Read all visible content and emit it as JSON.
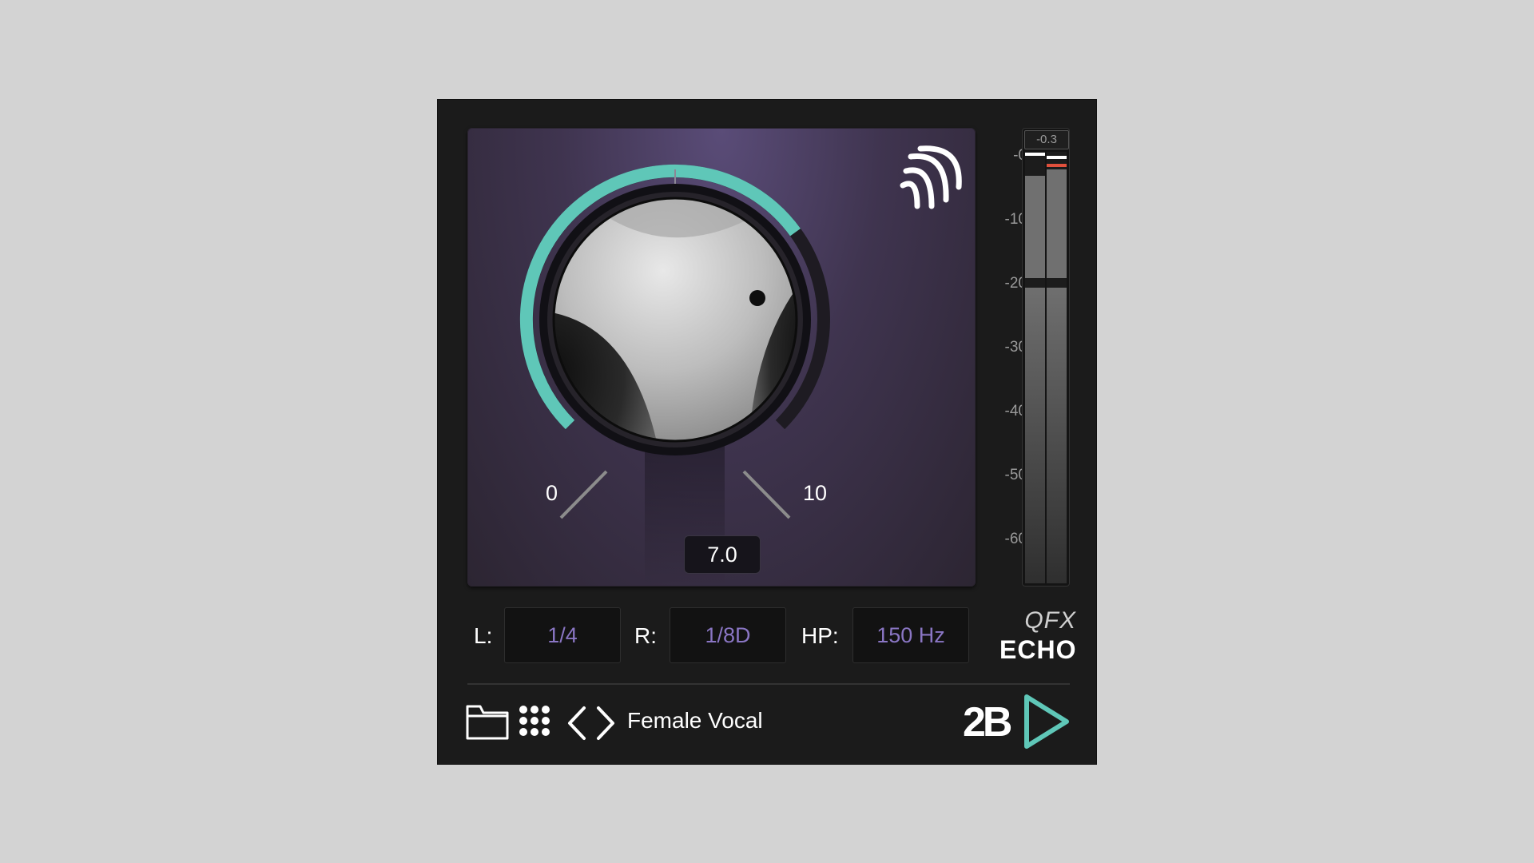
{
  "knob": {
    "min_label": "0",
    "max_label": "10",
    "value_text": "7.0",
    "value": 7.0,
    "min": 0,
    "max": 10
  },
  "meter": {
    "peak_readout": "-0.3",
    "scale_ticks": [
      "-0",
      "-10",
      "-20",
      "-30",
      "-40",
      "-50",
      "-60"
    ],
    "left_level_db": -20,
    "right_level_db": -20
  },
  "params": {
    "left_label": "L:",
    "left_value": "1/4",
    "right_label": "R:",
    "right_value": "1/8D",
    "hp_label": "HP:",
    "hp_value": "150 Hz"
  },
  "product": {
    "line1": "QFX",
    "line2": "ECHO"
  },
  "preset": {
    "name": "Female Vocal"
  },
  "brand": {
    "text": "2B"
  },
  "colors": {
    "accent": "#5fc7b8",
    "param_text": "#8a76c4",
    "panel": "#1b1b1b",
    "peak_red": "#e0503c"
  },
  "icons": {
    "folder": "folder-icon",
    "grid": "grid-icon",
    "prev": "chevron-left-icon",
    "next": "chevron-right-icon",
    "echo": "echo-waves-icon"
  }
}
